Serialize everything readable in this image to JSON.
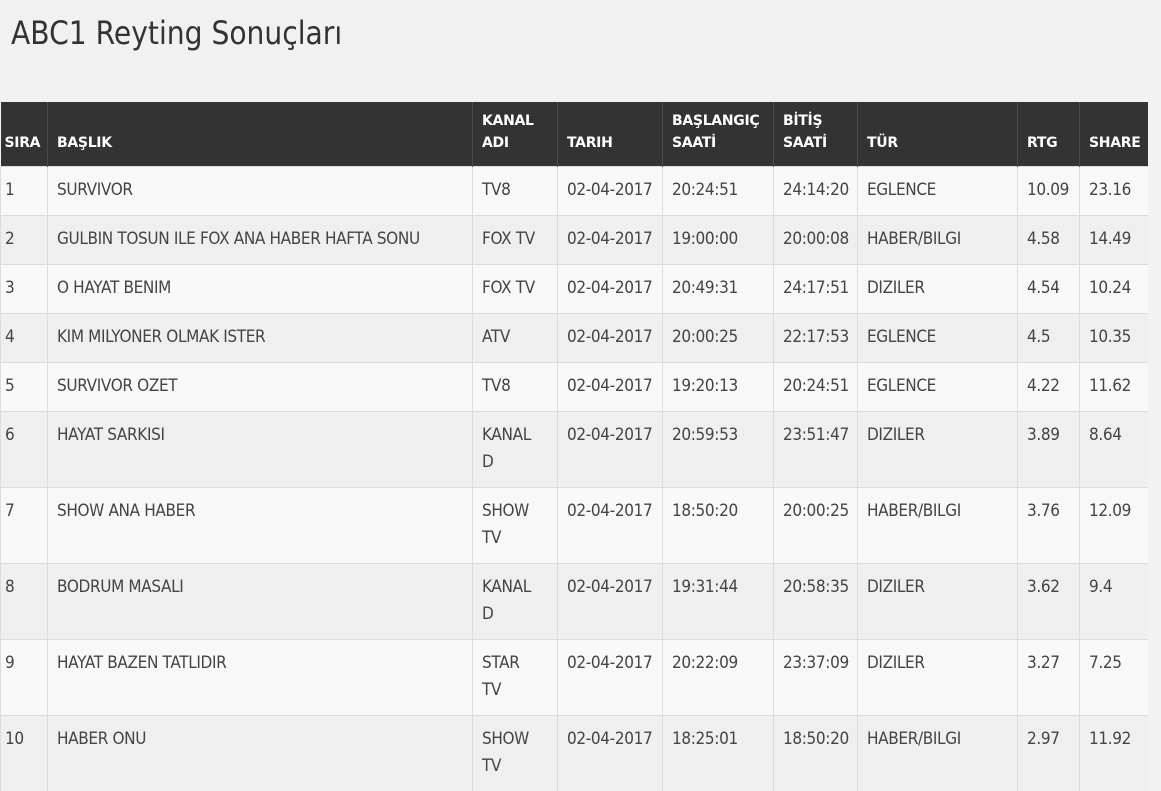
{
  "page": {
    "title": "ABC1 Reyting Sonuçları"
  },
  "table": {
    "headers": [
      {
        "key": "sira",
        "label": "SIRA"
      },
      {
        "key": "baslik",
        "label": "BAŞLIK"
      },
      {
        "key": "kanal",
        "label": "KANAL ADI"
      },
      {
        "key": "tarih",
        "label": "TARIH"
      },
      {
        "key": "baslangic",
        "label": "BAŞLANGIÇ SAATİ"
      },
      {
        "key": "bitis",
        "label": "BİTİŞ SAATİ"
      },
      {
        "key": "tur",
        "label": "TÜR"
      },
      {
        "key": "rtg",
        "label": "RTG"
      },
      {
        "key": "share",
        "label": "SHARE"
      }
    ],
    "rows": [
      [
        "1",
        "SURVIVOR",
        "TV8",
        "02-04-2017",
        "20:24:51",
        "24:14:20",
        "EGLENCE",
        "10.09",
        "23.16"
      ],
      [
        "2",
        "GULBIN TOSUN ILE FOX ANA HABER HAFTA SONU",
        "FOX TV",
        "02-04-2017",
        "19:00:00",
        "20:00:08",
        "HABER/BILGI",
        "4.58",
        "14.49"
      ],
      [
        "3",
        "O HAYAT BENIM",
        "FOX TV",
        "02-04-2017",
        "20:49:31",
        "24:17:51",
        "DIZILER",
        "4.54",
        "10.24"
      ],
      [
        "4",
        "KIM MILYONER OLMAK ISTER",
        "ATV",
        "02-04-2017",
        "20:00:25",
        "22:17:53",
        "EGLENCE",
        "4.5",
        "10.35"
      ],
      [
        "5",
        "SURVIVOR OZET",
        "TV8",
        "02-04-2017",
        "19:20:13",
        "20:24:51",
        "EGLENCE",
        "4.22",
        "11.62"
      ],
      [
        "6",
        "HAYAT SARKISI",
        "KANAL D",
        "02-04-2017",
        "20:59:53",
        "23:51:47",
        "DIZILER",
        "3.89",
        "8.64"
      ],
      [
        "7",
        "SHOW ANA HABER",
        "SHOW TV",
        "02-04-2017",
        "18:50:20",
        "20:00:25",
        "HABER/BILGI",
        "3.76",
        "12.09"
      ],
      [
        "8",
        "BODRUM MASALI",
        "KANAL D",
        "02-04-2017",
        "19:31:44",
        "20:58:35",
        "DIZILER",
        "3.62",
        "9.4"
      ],
      [
        "9",
        "HAYAT BAZEN TATLIDIR",
        "STAR TV",
        "02-04-2017",
        "20:22:09",
        "23:37:09",
        "DIZILER",
        "3.27",
        "7.25"
      ],
      [
        "10",
        "HABER ONU",
        "SHOW TV",
        "02-04-2017",
        "18:25:01",
        "18:50:20",
        "HABER/BILGI",
        "2.97",
        "11.92"
      ]
    ]
  },
  "colors": {
    "header_bg": "#333333",
    "header_text": "#ffffff",
    "row_odd": "#f8f8f8",
    "row_even": "#efefef"
  }
}
